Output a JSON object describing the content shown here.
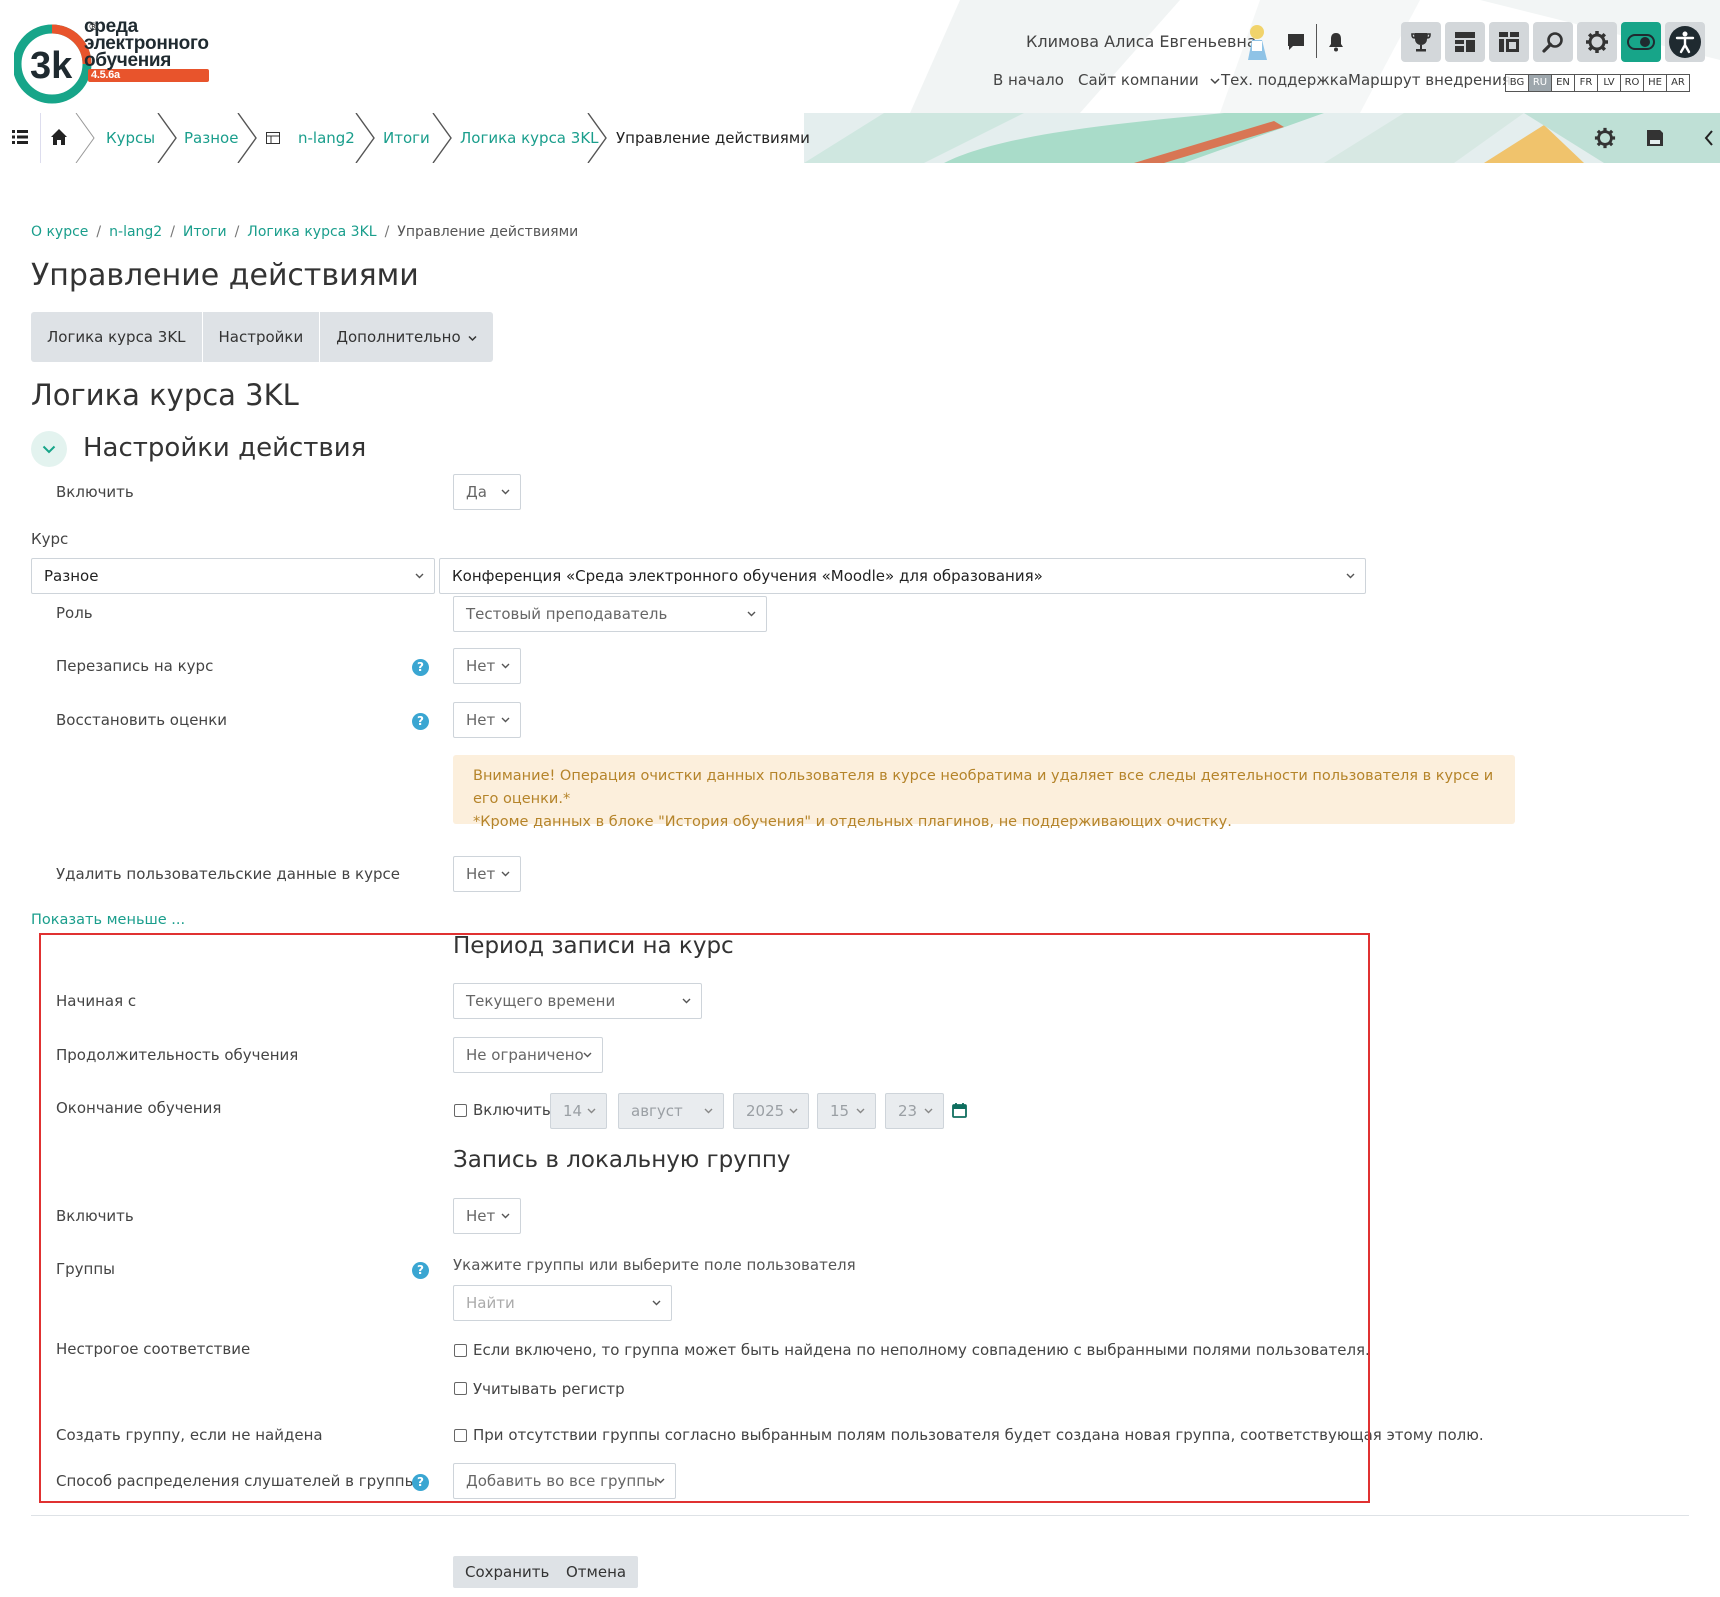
{
  "header": {
    "logo_line1": "среда",
    "logo_line2": "электронного",
    "logo_line3": "обучения",
    "logo_version": "4.5.6a",
    "logo_mark": "®",
    "user_name": "Климова Алиса Евгеньевна",
    "nav": {
      "home": "В начало",
      "company": "Сайт компании",
      "support": "Тех. поддержка",
      "route": "Маршрут внедрения"
    },
    "languages": [
      "BG",
      "RU",
      "EN",
      "FR",
      "LV",
      "RO",
      "HE",
      "AR"
    ],
    "active_language": "RU",
    "accent_color": "#17a589",
    "icons": [
      "chat-icon",
      "bell-icon",
      "trophy-icon",
      "dashboard-icon",
      "layout-icon",
      "search-icon",
      "gear-icon",
      "toggle-icon",
      "accessibility-icon"
    ]
  },
  "breadcrumb_bar": {
    "items": [
      "Курсы",
      "Разное",
      "n-lang2",
      "Итоги",
      "Логика курса 3KL",
      "Управление действиями"
    ]
  },
  "page": {
    "crumbs": [
      "О курсе",
      "n-lang2",
      "Итоги",
      "Логика курса 3KL",
      "Управление действиями"
    ],
    "title": "Управление действиями",
    "tabs": [
      "Логика курса 3KL",
      "Настройки",
      "Дополнительно"
    ],
    "subtitle": "Логика курса 3KL",
    "section_title": "Настройки действия"
  },
  "form": {
    "enable_label": "Включить",
    "enable_value": "Да",
    "course_label": "Курс",
    "category_value": "Разное",
    "course_value": "Конференция «Среда электронного обучения «Moodle» для образования»",
    "role_label": "Роль",
    "role_value": "Тестовый преподаватель",
    "reenrol_label": "Перезапись на курс",
    "reenrol_value": "Нет",
    "restore_label": "Восстановить оценки",
    "restore_value": "Нет",
    "alert_line1": "Внимание! Операция очистки данных пользователя в курсе необратима и удаляет все следы деятельности пользователя в курсе и его оценки.*",
    "alert_line2": "*Кроме данных в блоке \"История обучения\" и отдельных плагинов, не поддерживающих очистку.",
    "delete_label": "Удалить пользовательские данные в курсе",
    "delete_value": "Нет",
    "show_less": "Показать меньше ...",
    "period_title": "Период записи на курс",
    "start_label": "Начиная с",
    "start_value": "Текущего времени",
    "duration_label": "Продолжительность обучения",
    "duration_value": "Не ограничено",
    "end_label": "Окончание обучения",
    "end_enable": "Включить",
    "end_day": "14",
    "end_month": "август",
    "end_year": "2025",
    "end_hour": "15",
    "end_minute": "23",
    "group_title": "Запись в локальную группу",
    "group_enable_label": "Включить",
    "group_enable_value": "Нет",
    "groups_label": "Группы",
    "groups_hint": "Укажите группы или выберите поле пользователя",
    "groups_placeholder": "Найти",
    "fuzzy_label": "Нестрогое соответствие",
    "fuzzy_text": "Если включено, то группа может быть найдена по неполному совпадению с выбранными полями пользователя.",
    "case_text": "Учитывать регистр",
    "create_label": "Создать группу, если не найдена",
    "create_text": "При отсутствии группы согласно выбранным полям пользователя будет создана новая группа, соответствующая этому полю.",
    "distribution_label": "Способ распределения слушателей в группы",
    "distribution_value": "Добавить во все группы",
    "help_glyph": "?"
  },
  "buttons": {
    "save": "Сохранить",
    "cancel": "Отмена"
  }
}
